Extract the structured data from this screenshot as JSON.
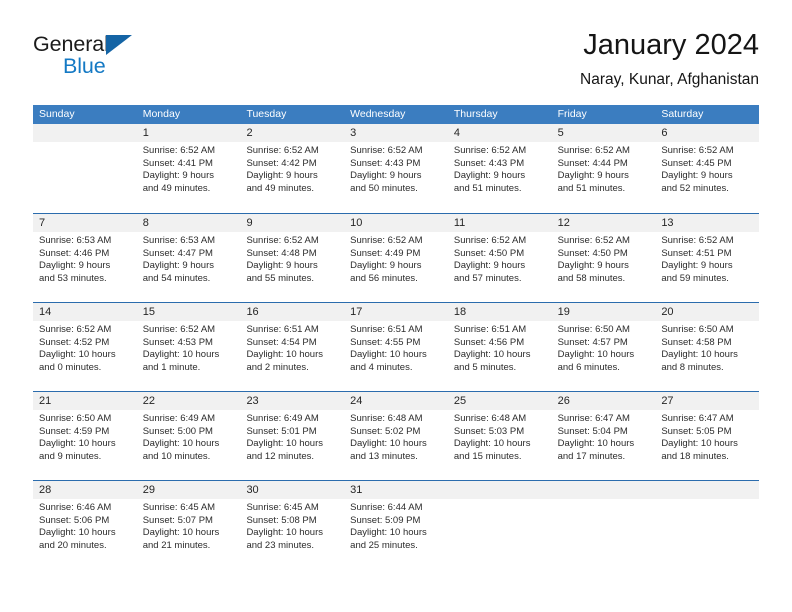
{
  "brand": {
    "name_part1": "General",
    "name_part2": "Blue",
    "triangle_color": "#1464a5",
    "blue_color": "#1479c4"
  },
  "header": {
    "title": "January 2024",
    "subtitle": "Naray, Kunar, Afghanistan"
  },
  "theme": {
    "header_bar_color": "#3b7dc0",
    "week_divider_color": "#2b6cad",
    "daynum_band_color": "#f1f1f1",
    "text_color": "#2c2c2c"
  },
  "weekday_headers": [
    "Sunday",
    "Monday",
    "Tuesday",
    "Wednesday",
    "Thursday",
    "Friday",
    "Saturday"
  ],
  "weeks": [
    [
      {
        "day": "",
        "lines": []
      },
      {
        "day": "1",
        "lines": [
          "Sunrise: 6:52 AM",
          "Sunset: 4:41 PM",
          "Daylight: 9 hours",
          "and 49 minutes."
        ]
      },
      {
        "day": "2",
        "lines": [
          "Sunrise: 6:52 AM",
          "Sunset: 4:42 PM",
          "Daylight: 9 hours",
          "and 49 minutes."
        ]
      },
      {
        "day": "3",
        "lines": [
          "Sunrise: 6:52 AM",
          "Sunset: 4:43 PM",
          "Daylight: 9 hours",
          "and 50 minutes."
        ]
      },
      {
        "day": "4",
        "lines": [
          "Sunrise: 6:52 AM",
          "Sunset: 4:43 PM",
          "Daylight: 9 hours",
          "and 51 minutes."
        ]
      },
      {
        "day": "5",
        "lines": [
          "Sunrise: 6:52 AM",
          "Sunset: 4:44 PM",
          "Daylight: 9 hours",
          "and 51 minutes."
        ]
      },
      {
        "day": "6",
        "lines": [
          "Sunrise: 6:52 AM",
          "Sunset: 4:45 PM",
          "Daylight: 9 hours",
          "and 52 minutes."
        ]
      }
    ],
    [
      {
        "day": "7",
        "lines": [
          "Sunrise: 6:53 AM",
          "Sunset: 4:46 PM",
          "Daylight: 9 hours",
          "and 53 minutes."
        ]
      },
      {
        "day": "8",
        "lines": [
          "Sunrise: 6:53 AM",
          "Sunset: 4:47 PM",
          "Daylight: 9 hours",
          "and 54 minutes."
        ]
      },
      {
        "day": "9",
        "lines": [
          "Sunrise: 6:52 AM",
          "Sunset: 4:48 PM",
          "Daylight: 9 hours",
          "and 55 minutes."
        ]
      },
      {
        "day": "10",
        "lines": [
          "Sunrise: 6:52 AM",
          "Sunset: 4:49 PM",
          "Daylight: 9 hours",
          "and 56 minutes."
        ]
      },
      {
        "day": "11",
        "lines": [
          "Sunrise: 6:52 AM",
          "Sunset: 4:50 PM",
          "Daylight: 9 hours",
          "and 57 minutes."
        ]
      },
      {
        "day": "12",
        "lines": [
          "Sunrise: 6:52 AM",
          "Sunset: 4:50 PM",
          "Daylight: 9 hours",
          "and 58 minutes."
        ]
      },
      {
        "day": "13",
        "lines": [
          "Sunrise: 6:52 AM",
          "Sunset: 4:51 PM",
          "Daylight: 9 hours",
          "and 59 minutes."
        ]
      }
    ],
    [
      {
        "day": "14",
        "lines": [
          "Sunrise: 6:52 AM",
          "Sunset: 4:52 PM",
          "Daylight: 10 hours",
          "and 0 minutes."
        ]
      },
      {
        "day": "15",
        "lines": [
          "Sunrise: 6:52 AM",
          "Sunset: 4:53 PM",
          "Daylight: 10 hours",
          "and 1 minute."
        ]
      },
      {
        "day": "16",
        "lines": [
          "Sunrise: 6:51 AM",
          "Sunset: 4:54 PM",
          "Daylight: 10 hours",
          "and 2 minutes."
        ]
      },
      {
        "day": "17",
        "lines": [
          "Sunrise: 6:51 AM",
          "Sunset: 4:55 PM",
          "Daylight: 10 hours",
          "and 4 minutes."
        ]
      },
      {
        "day": "18",
        "lines": [
          "Sunrise: 6:51 AM",
          "Sunset: 4:56 PM",
          "Daylight: 10 hours",
          "and 5 minutes."
        ]
      },
      {
        "day": "19",
        "lines": [
          "Sunrise: 6:50 AM",
          "Sunset: 4:57 PM",
          "Daylight: 10 hours",
          "and 6 minutes."
        ]
      },
      {
        "day": "20",
        "lines": [
          "Sunrise: 6:50 AM",
          "Sunset: 4:58 PM",
          "Daylight: 10 hours",
          "and 8 minutes."
        ]
      }
    ],
    [
      {
        "day": "21",
        "lines": [
          "Sunrise: 6:50 AM",
          "Sunset: 4:59 PM",
          "Daylight: 10 hours",
          "and 9 minutes."
        ]
      },
      {
        "day": "22",
        "lines": [
          "Sunrise: 6:49 AM",
          "Sunset: 5:00 PM",
          "Daylight: 10 hours",
          "and 10 minutes."
        ]
      },
      {
        "day": "23",
        "lines": [
          "Sunrise: 6:49 AM",
          "Sunset: 5:01 PM",
          "Daylight: 10 hours",
          "and 12 minutes."
        ]
      },
      {
        "day": "24",
        "lines": [
          "Sunrise: 6:48 AM",
          "Sunset: 5:02 PM",
          "Daylight: 10 hours",
          "and 13 minutes."
        ]
      },
      {
        "day": "25",
        "lines": [
          "Sunrise: 6:48 AM",
          "Sunset: 5:03 PM",
          "Daylight: 10 hours",
          "and 15 minutes."
        ]
      },
      {
        "day": "26",
        "lines": [
          "Sunrise: 6:47 AM",
          "Sunset: 5:04 PM",
          "Daylight: 10 hours",
          "and 17 minutes."
        ]
      },
      {
        "day": "27",
        "lines": [
          "Sunrise: 6:47 AM",
          "Sunset: 5:05 PM",
          "Daylight: 10 hours",
          "and 18 minutes."
        ]
      }
    ],
    [
      {
        "day": "28",
        "lines": [
          "Sunrise: 6:46 AM",
          "Sunset: 5:06 PM",
          "Daylight: 10 hours",
          "and 20 minutes."
        ]
      },
      {
        "day": "29",
        "lines": [
          "Sunrise: 6:45 AM",
          "Sunset: 5:07 PM",
          "Daylight: 10 hours",
          "and 21 minutes."
        ]
      },
      {
        "day": "30",
        "lines": [
          "Sunrise: 6:45 AM",
          "Sunset: 5:08 PM",
          "Daylight: 10 hours",
          "and 23 minutes."
        ]
      },
      {
        "day": "31",
        "lines": [
          "Sunrise: 6:44 AM",
          "Sunset: 5:09 PM",
          "Daylight: 10 hours",
          "and 25 minutes."
        ]
      },
      {
        "day": "",
        "lines": []
      },
      {
        "day": "",
        "lines": []
      },
      {
        "day": "",
        "lines": []
      }
    ]
  ]
}
